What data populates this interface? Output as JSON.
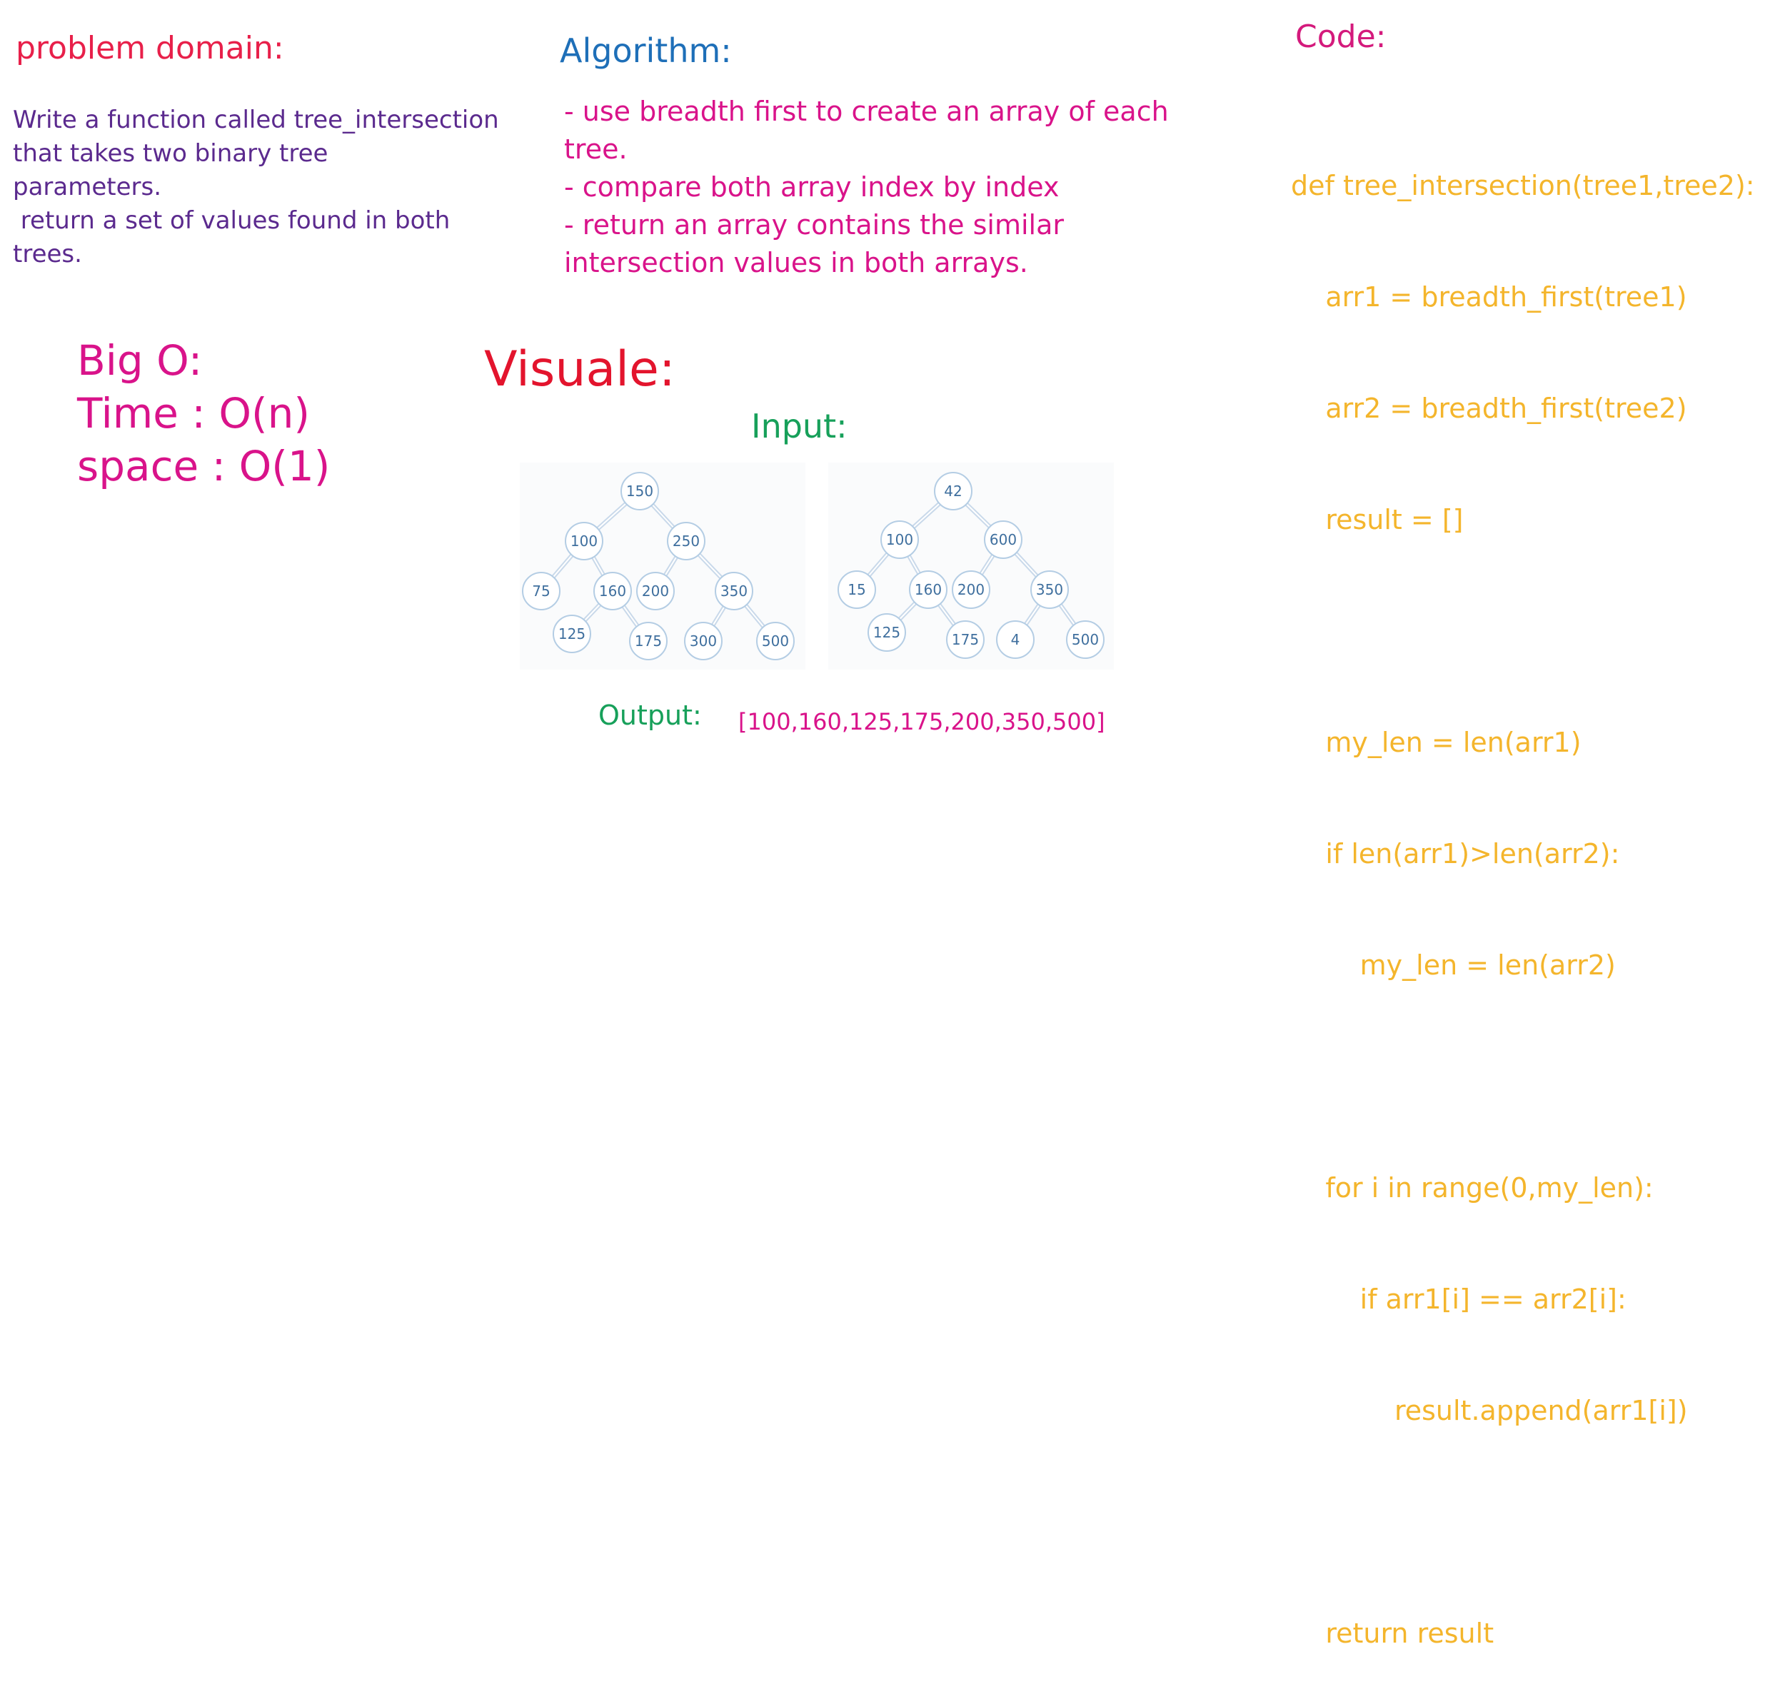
{
  "problem_domain": {
    "title": "problem domain:",
    "lines": [
      "Write a function called tree_intersection",
      "that takes two binary tree",
      "parameters.",
      " return a set of values found in both",
      "trees."
    ]
  },
  "algorithm": {
    "title": "Algorithm:",
    "lines": [
      "- use breadth first to create an array of each",
      "tree.",
      "- compare both array index by index",
      "- return an array contains the similar",
      "intersection values in both arrays."
    ]
  },
  "code": {
    "title": "Code:",
    "lines": [
      "def tree_intersection(tree1,tree2):",
      "    arr1 = breadth_first(tree1)",
      "    arr2 = breadth_first(tree2)",
      "    result = []",
      "",
      "    my_len = len(arr1)",
      "    if len(arr1)>len(arr2):",
      "        my_len = len(arr2)",
      "",
      "    for i in range(0,my_len):",
      "        if arr1[i] == arr2[i]:",
      "            result.append(arr1[i])",
      "",
      "    return result"
    ]
  },
  "big_o": {
    "title": "Big O:",
    "time": "Time : O(n)",
    "space": "space : O(1)"
  },
  "visual": {
    "title": "Visuale:",
    "input_label": "Input:",
    "output_label": "Output:",
    "output_value": "[100,160,125,175,200,350,500]"
  },
  "trees": [
    {
      "nodes": [
        {
          "id": "a",
          "label": "150"
        },
        {
          "id": "b",
          "label": "100"
        },
        {
          "id": "c",
          "label": "250"
        },
        {
          "id": "d",
          "label": "75"
        },
        {
          "id": "e",
          "label": "160"
        },
        {
          "id": "f",
          "label": "200"
        },
        {
          "id": "g",
          "label": "350"
        },
        {
          "id": "h",
          "label": "125"
        },
        {
          "id": "i",
          "label": "175"
        },
        {
          "id": "j",
          "label": "300"
        },
        {
          "id": "k",
          "label": "500"
        }
      ],
      "edges": [
        [
          "a",
          "b"
        ],
        [
          "a",
          "c"
        ],
        [
          "b",
          "d"
        ],
        [
          "b",
          "e"
        ],
        [
          "c",
          "f"
        ],
        [
          "c",
          "g"
        ],
        [
          "e",
          "h"
        ],
        [
          "e",
          "i"
        ],
        [
          "g",
          "j"
        ],
        [
          "g",
          "k"
        ]
      ]
    },
    {
      "nodes": [
        {
          "id": "a",
          "label": "42"
        },
        {
          "id": "b",
          "label": "100"
        },
        {
          "id": "c",
          "label": "600"
        },
        {
          "id": "d",
          "label": "15"
        },
        {
          "id": "e",
          "label": "160"
        },
        {
          "id": "f",
          "label": "200"
        },
        {
          "id": "g",
          "label": "350"
        },
        {
          "id": "h",
          "label": "125"
        },
        {
          "id": "i",
          "label": "175"
        },
        {
          "id": "j",
          "label": "4"
        },
        {
          "id": "k",
          "label": "500"
        }
      ],
      "edges": [
        [
          "a",
          "b"
        ],
        [
          "a",
          "c"
        ],
        [
          "b",
          "d"
        ],
        [
          "b",
          "e"
        ],
        [
          "c",
          "f"
        ],
        [
          "c",
          "g"
        ],
        [
          "e",
          "h"
        ],
        [
          "e",
          "i"
        ],
        [
          "g",
          "j"
        ],
        [
          "g",
          "k"
        ]
      ]
    }
  ]
}
